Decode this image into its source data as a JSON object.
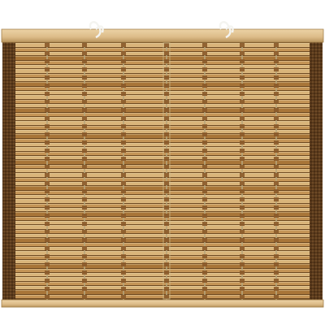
{
  "photo": {
    "subject": "roll-up-bamboo-blind",
    "colors": {
      "background": "#ffffff",
      "rail_light": "#e2c494",
      "rail_dark": "#b8935c",
      "slat_light": "#d9b47a",
      "slat_mid": "#c49456",
      "slat_dark": "#a87538",
      "gap": "#6e4a22",
      "edge_binding": "#5a3a1c",
      "weave_cord": "#8a5a2a",
      "string": "#f2f2ee"
    },
    "hanging_strings": 2,
    "ladder_cords": 6
  }
}
